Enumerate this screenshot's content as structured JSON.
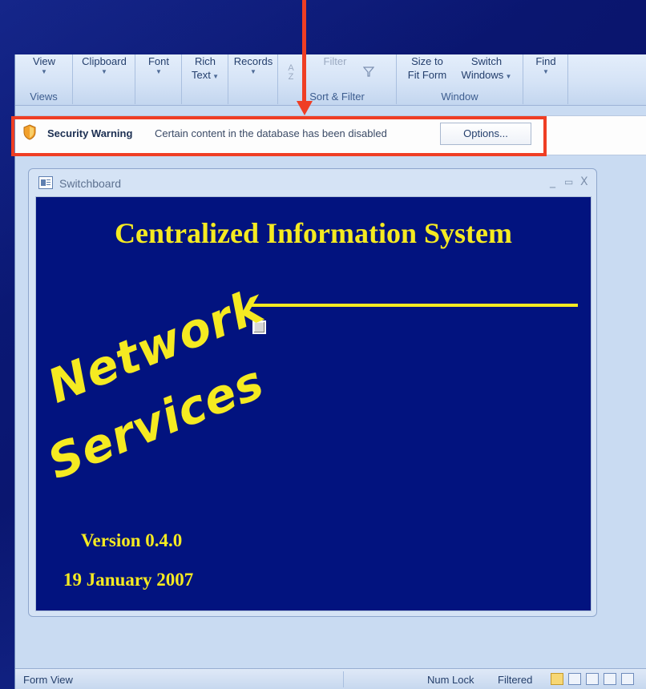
{
  "ribbon": {
    "groups": [
      {
        "caption": "Views",
        "buttons": [
          {
            "label": "View",
            "dropdown": true
          }
        ]
      },
      {
        "caption": "",
        "buttons": [
          {
            "label": "Clipboard",
            "dropdown": true
          }
        ]
      },
      {
        "caption": "",
        "buttons": [
          {
            "label": "Font",
            "dropdown": true
          }
        ]
      },
      {
        "caption": "",
        "buttons": [
          {
            "label": "Rich",
            "label2": "Text",
            "dropdown": true
          }
        ]
      },
      {
        "caption": "",
        "buttons": [
          {
            "label": "Records",
            "dropdown": true
          }
        ]
      },
      {
        "caption": "Sort & Filter",
        "buttons": [
          {
            "label": "Filter",
            "disabled": true
          }
        ]
      },
      {
        "caption": "Window",
        "buttons": [
          {
            "label": "Size to",
            "label2": "Fit Form"
          },
          {
            "label": "Switch",
            "label2": "Windows",
            "dropdown": true
          }
        ]
      },
      {
        "caption": "",
        "buttons": [
          {
            "label": "Find",
            "dropdown": true
          }
        ]
      }
    ]
  },
  "message_bar": {
    "title": "Security Warning",
    "text": "Certain content in the database has been disabled",
    "options_label": "Options..."
  },
  "form": {
    "window_title": "Switchboard",
    "controls": {
      "minimize": "_",
      "maximize": "▭",
      "close": "X"
    },
    "main_title": "Centralized Information System",
    "logo_line1": "Network",
    "logo_line2": "Services",
    "version": "Version 0.4.0",
    "date": "19 January 2007"
  },
  "status_bar": {
    "view": "Form View",
    "num_lock": "Num Lock",
    "filtered": "Filtered"
  },
  "colors": {
    "highlight": "#ef3e24",
    "form_background": "#02137f",
    "form_text": "#f5ea21"
  }
}
